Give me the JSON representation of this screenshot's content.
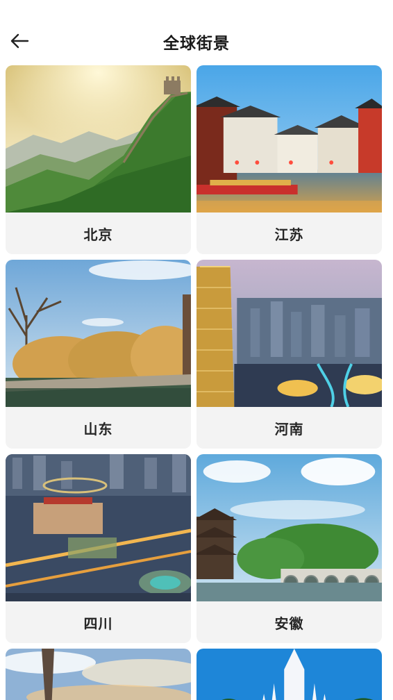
{
  "header": {
    "title": "全球街景",
    "back_icon": "arrow-left-icon"
  },
  "cards": [
    {
      "label": "北京",
      "image": "great-wall-mountains"
    },
    {
      "label": "江苏",
      "image": "riverside-ancient-town"
    },
    {
      "label": "山东",
      "image": "lakeside-willows"
    },
    {
      "label": "河南",
      "image": "city-skyline-tower"
    },
    {
      "label": "四川",
      "image": "city-square-aerial"
    },
    {
      "label": "安徽",
      "image": "pavilion-stone-bridge"
    },
    {
      "label": "",
      "image": "tower-sky"
    },
    {
      "label": "",
      "image": "white-cathedral-palms"
    }
  ],
  "colors": {
    "card_bg": "#f3f3f3",
    "text": "#262626"
  }
}
